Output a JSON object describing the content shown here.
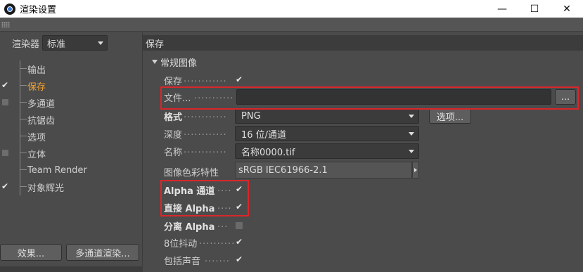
{
  "window": {
    "title": "渲染设置",
    "minimize": "—",
    "maximize": "☐",
    "close": "✕"
  },
  "left": {
    "renderer_label": "渲染器",
    "renderer_value": "标准",
    "items": [
      {
        "label": "输出",
        "check": "none"
      },
      {
        "label": "保存",
        "check": "checked",
        "active": true
      },
      {
        "label": "多通道",
        "check": "box"
      },
      {
        "label": "抗锯齿",
        "check": "none"
      },
      {
        "label": "选项",
        "check": "none"
      },
      {
        "label": "立体",
        "check": "box"
      },
      {
        "label": "Team Render",
        "check": "none"
      },
      {
        "label": "对象辉光",
        "check": "checked"
      }
    ],
    "effects_button": "效果...",
    "multipass_button": "多通道渲染..."
  },
  "right": {
    "section_title": "保存",
    "subsection_title": "常规图像",
    "save": {
      "label": "保存",
      "dots": "............",
      "checked": true
    },
    "file": {
      "label": "文件...",
      "dots": "...........",
      "value": "",
      "browse": "..."
    },
    "format": {
      "label": "格式",
      "dots": "............",
      "value": "PNG",
      "options_button": "选项..."
    },
    "depth": {
      "label": "深度",
      "dots": "............",
      "value": "16 位/通道"
    },
    "name": {
      "label": "名称",
      "dots": "............",
      "value": "名称0000.tif"
    },
    "color_profile": {
      "label": "图像色彩特性",
      "value": "sRGB IEC61966-2.1"
    },
    "alpha_channel": {
      "label": "Alpha 通道",
      "dots": "....",
      "checked": true
    },
    "straight_alpha": {
      "label": "直接 Alpha",
      "dots": "....",
      "checked": true
    },
    "separate_alpha": {
      "label": "分离 Alpha",
      "dots": "...",
      "checked": false
    },
    "dithering": {
      "label": "8位抖动",
      "dots": "..........",
      "checked": true
    },
    "include_sound": {
      "label": "包括声音",
      "dots": ".......",
      "checked": true
    }
  },
  "check_glyph": "✔"
}
